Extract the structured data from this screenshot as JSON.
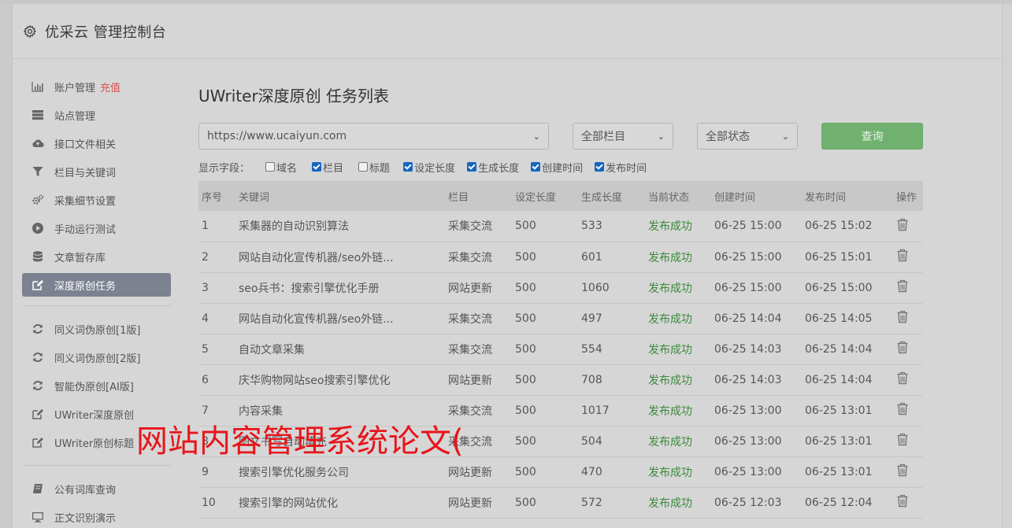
{
  "header": {
    "title": "优采云 管理控制台"
  },
  "sidebar": {
    "items": [
      {
        "label": "账户管理",
        "badge": "充值",
        "icon": "bar-chart-icon"
      },
      {
        "label": "站点管理",
        "icon": "server-icon"
      },
      {
        "label": "接口文件相关",
        "icon": "cloud-upload-icon"
      },
      {
        "label": "栏目与关键词",
        "icon": "filter-icon"
      },
      {
        "label": "采集细节设置",
        "icon": "gears-icon"
      },
      {
        "label": "手动运行测试",
        "icon": "play-icon"
      },
      {
        "label": "文章暂存库",
        "icon": "database-icon"
      },
      {
        "label": "深度原创任务",
        "icon": "edit-icon",
        "active": true
      }
    ],
    "items2": [
      {
        "label": "同义词伪原创[1版]",
        "icon": "refresh-icon"
      },
      {
        "label": "同义词伪原创[2版]",
        "icon": "refresh-icon"
      },
      {
        "label": "智能伪原创[AI版]",
        "icon": "refresh-icon"
      },
      {
        "label": "UWriter深度原创",
        "icon": "edit-icon"
      },
      {
        "label": "UWriter原创标题",
        "icon": "edit-icon"
      }
    ],
    "items3": [
      {
        "label": "公有词库查询",
        "icon": "book-icon"
      },
      {
        "label": "正文识别演示",
        "icon": "monitor-icon"
      }
    ]
  },
  "main": {
    "title": "UWriter深度原创 任务列表",
    "site_select": "https://www.ucaiyun.com",
    "column_select": "全部栏目",
    "status_select": "全部状态",
    "query_button": "查询",
    "fields_label": "显示字段：",
    "fields": [
      {
        "label": "域名",
        "checked": false
      },
      {
        "label": "栏目",
        "checked": true
      },
      {
        "label": "标题",
        "checked": false
      },
      {
        "label": "设定长度",
        "checked": true
      },
      {
        "label": "生成长度",
        "checked": true
      },
      {
        "label": "创建时间",
        "checked": true
      },
      {
        "label": "发布时间",
        "checked": true
      }
    ],
    "columns": [
      "序号",
      "关键词",
      "栏目",
      "设定长度",
      "生成长度",
      "当前状态",
      "创建时间",
      "发布时间",
      "操作"
    ],
    "rows": [
      [
        "1",
        "采集器的自动识别算法",
        "采集交流",
        "500",
        "533",
        "发布成功",
        "06-25 15:00",
        "06-25 15:02"
      ],
      [
        "2",
        "网站自动化宣传机器/seo外链...",
        "采集交流",
        "500",
        "601",
        "发布成功",
        "06-25 15:00",
        "06-25 15:01"
      ],
      [
        "3",
        "seo兵书：搜索引擎优化手册",
        "网站更新",
        "500",
        "1060",
        "发布成功",
        "06-25 15:00",
        "06-25 15:00"
      ],
      [
        "4",
        "网站自动化宣传机器/seo外链...",
        "采集交流",
        "500",
        "497",
        "发布成功",
        "06-25 14:04",
        "06-25 14:05"
      ],
      [
        "5",
        "自动文章采集",
        "采集交流",
        "500",
        "554",
        "发布成功",
        "06-25 14:03",
        "06-25 14:04"
      ],
      [
        "6",
        "庆华购物网站seo搜索引擎优化",
        "网站更新",
        "500",
        "708",
        "发布成功",
        "06-25 14:03",
        "06-25 14:04"
      ],
      [
        "7",
        "内容采集",
        "采集交流",
        "500",
        "1017",
        "发布成功",
        "06-25 13:00",
        "06-25 13:01"
      ],
      [
        "8",
        "图文书写自动填充",
        "采集交流",
        "500",
        "504",
        "发布成功",
        "06-25 13:00",
        "06-25 13:01"
      ],
      [
        "9",
        "搜索引擎优化服务公司",
        "网站更新",
        "500",
        "470",
        "发布成功",
        "06-25 13:00",
        "06-25 13:01"
      ],
      [
        "10",
        "搜索引擎的网站优化",
        "网站更新",
        "500",
        "572",
        "发布成功",
        "06-25 12:03",
        "06-25 12:04"
      ]
    ]
  },
  "overlay_text": "网站内容管理系统论文(",
  "colors": {
    "accent_green": "#71b16f",
    "status_green": "#3c8a3c",
    "overlay_red": "#e8141a",
    "active_bg": "#7c8290"
  }
}
